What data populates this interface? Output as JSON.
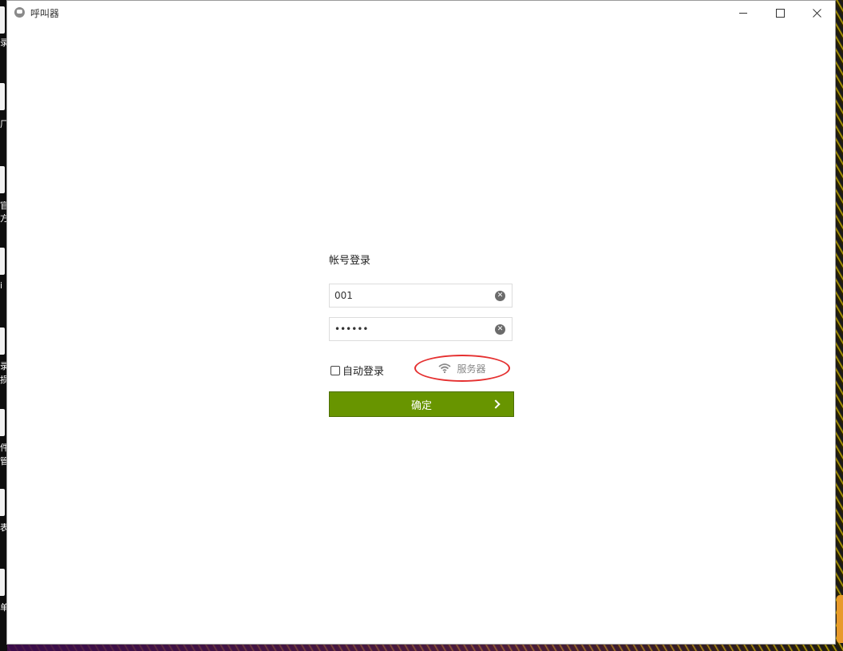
{
  "window": {
    "title": "呼叫器"
  },
  "desktop": {
    "labels": [
      "录",
      "厂",
      "官",
      "方",
      "i",
      "录",
      "损",
      "件",
      "管",
      "表",
      "单"
    ]
  },
  "login": {
    "title": "帐号登录",
    "username": {
      "value": "001",
      "placeholder": ""
    },
    "password": {
      "value": "••••••",
      "placeholder": ""
    },
    "remember_label": "自动登录",
    "remember_checked": false,
    "server_label": "服务器",
    "confirm_label": "确定"
  },
  "colors": {
    "confirm_button": "#689500",
    "highlight_ellipse": "#e53030"
  }
}
